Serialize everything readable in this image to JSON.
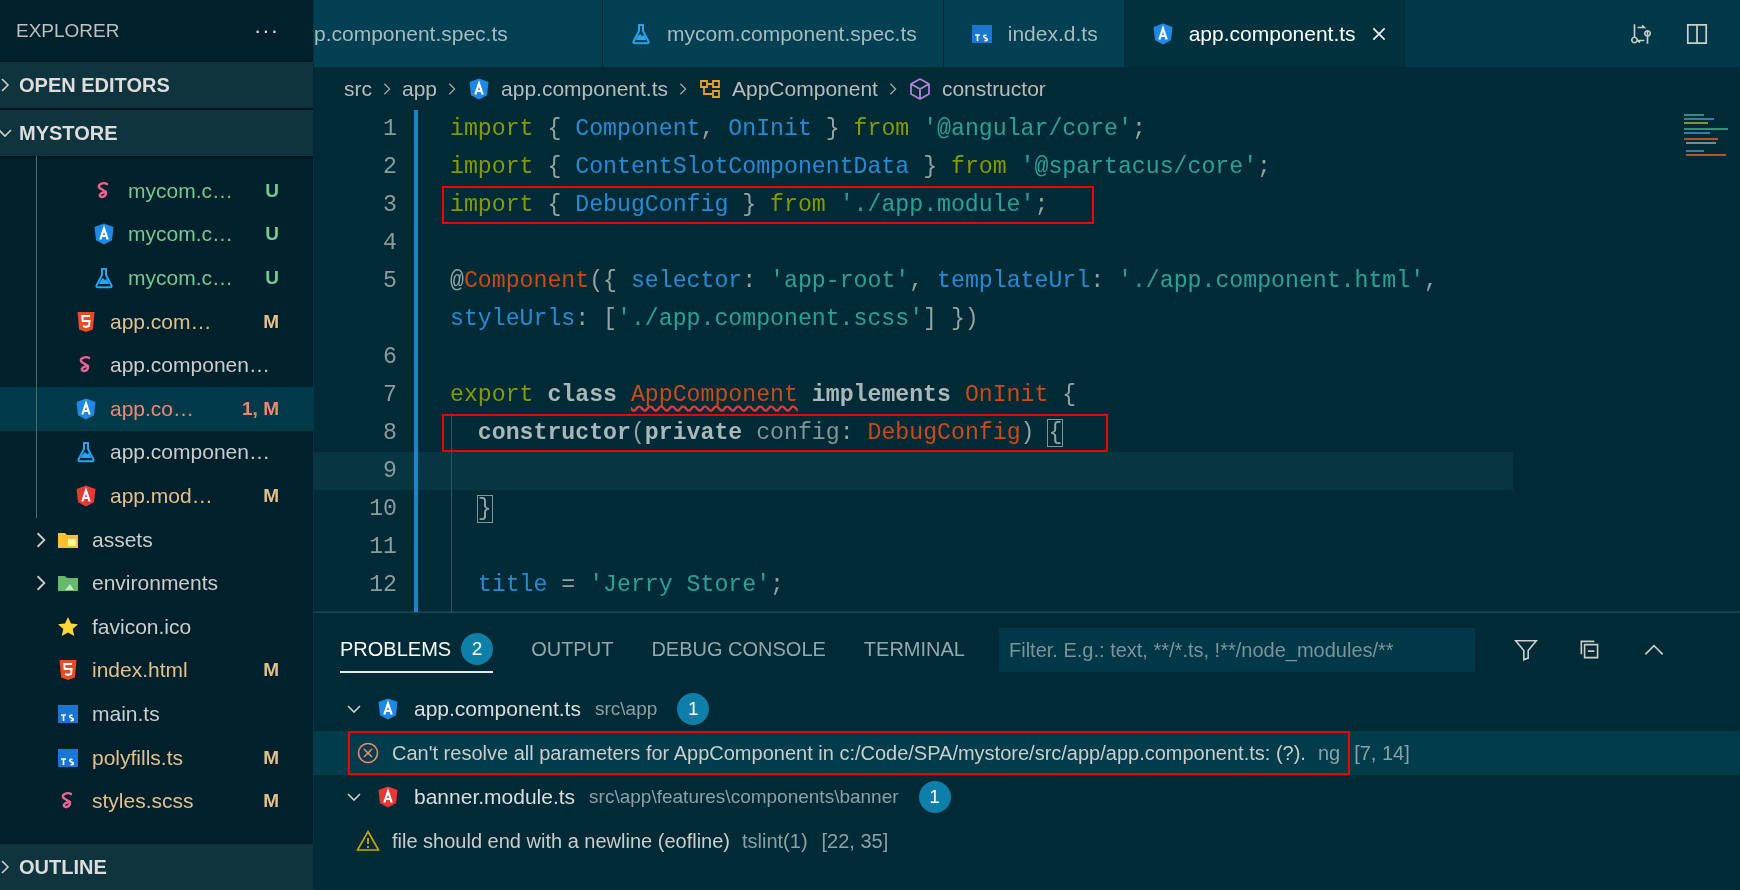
{
  "sidebar": {
    "title": "EXPLORER",
    "more": "···",
    "open_editors": {
      "label": "OPEN EDITORS",
      "expanded": false
    },
    "folder": {
      "label": "MYSTORE",
      "expanded": true,
      "tree": [
        {
          "children": [
            {
              "children": [
                {
                  "label": "mycom.c…",
                  "kind": "sass",
                  "status": "U",
                  "color": "#73c991",
                  "selected": false
                },
                {
                  "label": "mycom.c…",
                  "kind": "angular",
                  "status": "U",
                  "color": "#73c991",
                  "selected": false
                },
                {
                  "label": "mycom.c…",
                  "kind": "test",
                  "status": "U",
                  "color": "#73c991",
                  "selected": false
                }
              ]
            },
            {
              "label": "app.com…",
              "kind": "html",
              "status": "M",
              "color": "#e2c08d",
              "selected": false
            },
            {
              "label": "app.componen…",
              "kind": "sass",
              "selected": false
            },
            {
              "label": "app.co…",
              "kind": "angular",
              "status": "1, M",
              "color": "#f48771",
              "selected": true
            },
            {
              "label": "app.componen…",
              "kind": "test",
              "selected": false
            },
            {
              "label": "app.mod…",
              "kind": "angular-red",
              "status": "M",
              "color": "#e2c08d",
              "selected": false
            }
          ]
        },
        {
          "label": "assets",
          "kind": "folder-assets",
          "expanded": false,
          "selected": false
        },
        {
          "label": "environments",
          "kind": "folder-env",
          "expanded": false,
          "selected": false
        },
        {
          "label": "favicon.ico",
          "kind": "star",
          "selected": false
        },
        {
          "label": "index.html",
          "kind": "html",
          "status": "M",
          "color": "#e2c08d",
          "selected": false
        },
        {
          "label": "main.ts",
          "kind": "ts",
          "selected": false
        },
        {
          "label": "polyfills.ts",
          "kind": "ts",
          "status": "M",
          "color": "#e2c08d",
          "selected": false
        },
        {
          "label": "styles.scss",
          "kind": "sass",
          "status": "M",
          "color": "#e2c08d",
          "selected": false
        }
      ]
    },
    "outline": {
      "label": "OUTLINE",
      "expanded": false
    }
  },
  "tabs": [
    {
      "label": "p.component.spec.ts",
      "selected": false
    },
    {
      "label": "mycom.component.spec.ts",
      "kind": "test",
      "selected": false
    },
    {
      "label": "index.d.ts",
      "kind": "ts",
      "selected": false
    },
    {
      "label": "app.component.ts",
      "kind": "angular",
      "selected": true
    }
  ],
  "breadcrumb": [
    {
      "label": "src"
    },
    {
      "label": "app"
    },
    {
      "label": "app.component.ts",
      "kind": "angular"
    },
    {
      "label": "AppComponent",
      "kind": "class"
    },
    {
      "label": "constructor",
      "kind": "method"
    }
  ],
  "editor": {
    "lines": [
      {
        "number": "1",
        "current": false,
        "boxed": false,
        "tokens": [
          {
            "kind": "kw",
            "t": "import"
          },
          {
            "kind": "p",
            "t": " { "
          },
          {
            "kind": "name",
            "t": "Component"
          },
          {
            "kind": "p",
            "t": ", "
          },
          {
            "kind": "name",
            "t": "OnInit"
          },
          {
            "kind": "p",
            "t": " } "
          },
          {
            "kind": "kw",
            "t": "from "
          },
          {
            "kind": "str",
            "t": "'@angular/core'"
          },
          {
            "kind": "p",
            "t": ";"
          }
        ]
      },
      {
        "number": "2",
        "current": false,
        "boxed": false,
        "tokens": [
          {
            "kind": "kw",
            "t": "import"
          },
          {
            "kind": "p",
            "t": " { "
          },
          {
            "kind": "name",
            "t": "ContentSlotComponentData"
          },
          {
            "kind": "p",
            "t": " } "
          },
          {
            "kind": "kw",
            "t": "from "
          },
          {
            "kind": "str",
            "t": "'@spartacus/core'"
          },
          {
            "kind": "p",
            "t": ";"
          }
        ]
      },
      {
        "number": "3",
        "current": false,
        "boxed": true,
        "tokens": [
          {
            "kind": "kw",
            "t": "import"
          },
          {
            "kind": "p",
            "t": " { "
          },
          {
            "kind": "name",
            "t": "DebugConfig"
          },
          {
            "kind": "p",
            "t": " } "
          },
          {
            "kind": "kw",
            "t": "from "
          },
          {
            "kind": "str",
            "t": "'./app.module'"
          },
          {
            "kind": "p",
            "t": ";"
          }
        ]
      },
      {
        "number": "4",
        "current": false,
        "boxed": false
      },
      {
        "number": "5",
        "current": false,
        "boxed": false,
        "tokens": [
          {
            "kind": "p",
            "t": "@"
          },
          {
            "kind": "type",
            "t": "Component"
          },
          {
            "kind": "p",
            "t": "({ "
          },
          {
            "kind": "name",
            "t": "selector"
          },
          {
            "kind": "p",
            "t": ": "
          },
          {
            "kind": "str",
            "t": "'app-root'"
          },
          {
            "kind": "p",
            "t": ", "
          },
          {
            "kind": "name",
            "t": "templateUrl"
          },
          {
            "kind": "p",
            "t": ": "
          },
          {
            "kind": "str",
            "t": "'./app.component.html'"
          },
          {
            "kind": "p",
            "t": ","
          }
        ]
      },
      {
        "current": false,
        "boxed": false,
        "tokens": [
          {
            "kind": "name",
            "t": "styleUrls"
          },
          {
            "kind": "p",
            "t": ": ["
          },
          {
            "kind": "str",
            "t": "'./app.component.scss'"
          },
          {
            "kind": "p",
            "t": "] })"
          }
        ]
      },
      {
        "number": "6",
        "current": false,
        "boxed": false
      },
      {
        "number": "7",
        "current": false,
        "boxed": false,
        "tokens": [
          {
            "kind": "kw",
            "t": "export "
          },
          {
            "kind": "storage",
            "t": "class "
          },
          {
            "kind": "type",
            "t": "AppComponent",
            "squiggle": true
          },
          {
            "kind": "storage",
            "t": " implements "
          },
          {
            "kind": "type",
            "t": "OnInit"
          },
          {
            "kind": "p",
            "t": " {"
          }
        ]
      },
      {
        "number": "8",
        "indented": true,
        "current": false,
        "boxed": true,
        "tokens": [
          {
            "kind": "storage",
            "t": "constructor"
          },
          {
            "kind": "p",
            "t": "("
          },
          {
            "kind": "storage",
            "t": "private "
          },
          {
            "kind": "param",
            "t": "config"
          },
          {
            "kind": "p",
            "t": ": "
          },
          {
            "kind": "type",
            "t": "DebugConfig"
          },
          {
            "kind": "p",
            "t": ") "
          },
          {
            "kind": "bracket",
            "t": "{"
          }
        ]
      },
      {
        "number": "9",
        "current": true,
        "boxed": false
      },
      {
        "number": "10",
        "indented": true,
        "current": false,
        "boxed": false,
        "tokens": [
          {
            "kind": "bracket",
            "t": "}"
          }
        ]
      },
      {
        "number": "11",
        "current": false,
        "boxed": false
      },
      {
        "number": "12",
        "indented": true,
        "current": false,
        "boxed": false,
        "tokens": [
          {
            "kind": "name",
            "t": "title"
          },
          {
            "kind": "p",
            "t": " = "
          },
          {
            "kind": "str",
            "t": "'Jerry Store'"
          },
          {
            "kind": "p",
            "t": ";"
          }
        ]
      }
    ]
  },
  "panel": {
    "tabs": [
      {
        "label": "PROBLEMS",
        "badge": "2",
        "selected": true
      },
      {
        "label": "OUTPUT",
        "selected": false
      },
      {
        "label": "DEBUG CONSOLE",
        "selected": false
      },
      {
        "label": "TERMINAL",
        "selected": false
      }
    ],
    "filter": {
      "placeholder": "Filter. E.g.: text, **/*.ts, !**/node_modules/**"
    },
    "groups": [
      {
        "file": "app.component.ts",
        "path": "src\\app",
        "count": "1",
        "kind": "angular",
        "expanded": true,
        "items": [
          {
            "kind": "error",
            "message": "Can't resolve all parameters for AppComponent in c:/Code/SPA/mystore/src/app/app.component.ts: (?).",
            "source": "ng",
            "position": "[7, 14]",
            "selected": true,
            "boxed": true
          }
        ]
      },
      {
        "file": "banner.module.ts",
        "path": "src\\app\\features\\components\\banner",
        "count": "1",
        "kind": "angular-red",
        "expanded": true,
        "items": [
          {
            "kind": "warning",
            "message": "file should end with a newline (eofline)",
            "source": "tslint(1)",
            "position": "[22, 35]",
            "selected": false,
            "boxed": false
          }
        ]
      }
    ]
  }
}
